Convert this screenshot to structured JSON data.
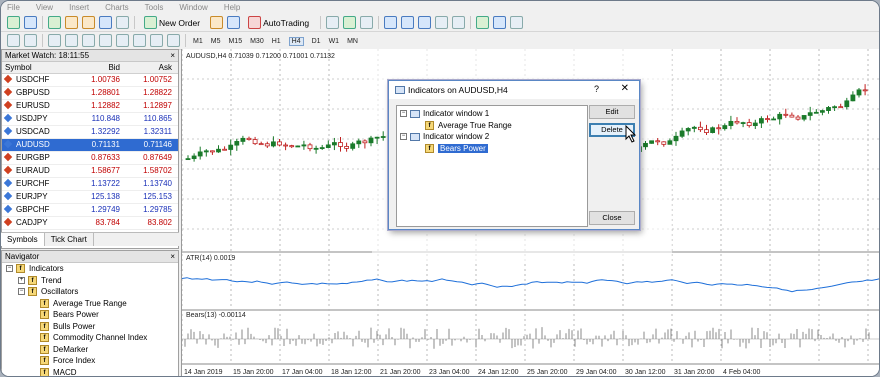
{
  "menu": [
    "File",
    "View",
    "Insert",
    "Charts",
    "Tools",
    "Window",
    "Help"
  ],
  "toolbar": {
    "new_order": "New Order",
    "autotrading": "AutoTrading",
    "timeframes": [
      "M1",
      "M5",
      "M15",
      "M30",
      "H1",
      "H4",
      "D1",
      "W1",
      "MN"
    ],
    "selected_tf": "H4"
  },
  "market_watch": {
    "title": "Market Watch: 18:11:55",
    "col_symbol": "Symbol",
    "col_bid": "Bid",
    "col_ask": "Ask",
    "rows": [
      {
        "symbol": "USDCHF",
        "bid": "1.00736",
        "ask": "1.00752",
        "dir": "down"
      },
      {
        "symbol": "GBPUSD",
        "bid": "1.28801",
        "ask": "1.28822",
        "dir": "down"
      },
      {
        "symbol": "EURUSD",
        "bid": "1.12882",
        "ask": "1.12897",
        "dir": "down"
      },
      {
        "symbol": "USDJPY",
        "bid": "110.848",
        "ask": "110.865",
        "dir": "up"
      },
      {
        "symbol": "USDCAD",
        "bid": "1.32292",
        "ask": "1.32311",
        "dir": "up"
      },
      {
        "symbol": "AUDUSD",
        "bid": "0.71131",
        "ask": "0.71146",
        "dir": "up"
      },
      {
        "symbol": "EURGBP",
        "bid": "0.87633",
        "ask": "0.87649",
        "dir": "down"
      },
      {
        "symbol": "EURAUD",
        "bid": "1.58677",
        "ask": "1.58702",
        "dir": "down"
      },
      {
        "symbol": "EURCHF",
        "bid": "1.13722",
        "ask": "1.13740",
        "dir": "up"
      },
      {
        "symbol": "EURJPY",
        "bid": "125.138",
        "ask": "125.153",
        "dir": "up"
      },
      {
        "symbol": "GBPCHF",
        "bid": "1.29749",
        "ask": "1.29785",
        "dir": "up"
      },
      {
        "symbol": "CADJPY",
        "bid": "83.784",
        "ask": "83.802",
        "dir": "down"
      }
    ],
    "selected": "AUDUSD",
    "tabs": [
      "Symbols",
      "Tick Chart"
    ]
  },
  "navigator": {
    "title": "Navigator",
    "items": [
      "Indicators",
      "Trend",
      "Oscillators",
      "Average True Range",
      "Bears Power",
      "Bulls Power",
      "Commodity Channel Index",
      "DeMarker",
      "Force Index",
      "MACD"
    ]
  },
  "chart": {
    "symbol_info": "AUDUSD,H4  0.71039 0.71200 0.71001 0.71132",
    "atr_label": "ATR(14) 0.0019",
    "bears_label": "Bears(13) -0.00114",
    "dates": [
      "14 Jan 2019",
      "15 Jan 20:00",
      "17 Jan 04:00",
      "18 Jan 12:00",
      "21 Jan 20:00",
      "23 Jan 04:00",
      "24 Jan 12:00",
      "25 Jan 20:00",
      "29 Jan 04:00",
      "30 Jan 12:00",
      "31 Jan 20:00",
      "4 Feb 04:00"
    ]
  },
  "dialog": {
    "title": "Indicators on AUDUSD,H4",
    "question": "?",
    "window1": "Indicator window 1",
    "ind1": "Average True Range",
    "window2": "Indicator window 2",
    "ind2": "Bears Power",
    "edit": "Edit",
    "delete": "Delete",
    "close": "Close"
  }
}
